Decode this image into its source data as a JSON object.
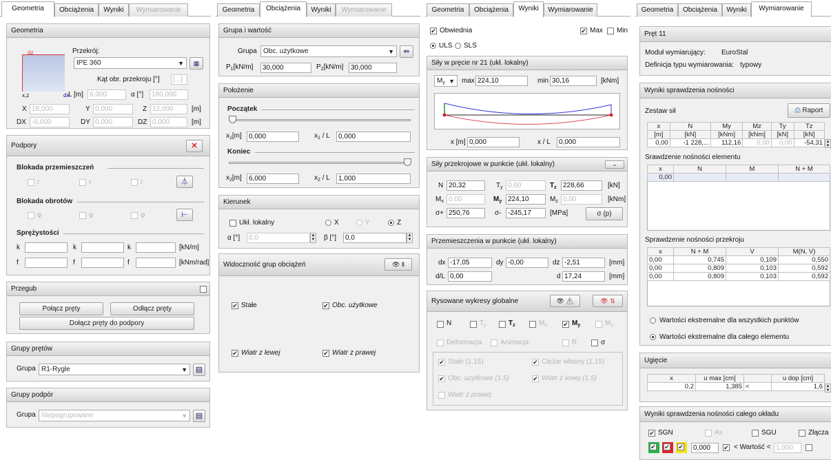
{
  "tabs": {
    "geometria": "Geometria",
    "obciazenia": "Obciążenia",
    "wyniki": "Wyniki",
    "wymiarowanie": "Wymiarowanie"
  },
  "p1": {
    "geom_title": "Geometria",
    "przekroj_label": "Przekrój:",
    "przekroj_value": "IPE 360",
    "kat_label": "Kąt obr. przekroju [°]",
    "kat_value": "[...]",
    "dz": "dz",
    "xz": "x,z",
    "dx": "dx",
    "L_label": "L [m]",
    "L_value": "6,000",
    "alfa_label": "α [°]",
    "alfa_value": "180,000",
    "X_label": "X",
    "X_value": "18,000",
    "Y_label": "Y",
    "Y_value": "0,000",
    "Z_label": "Z",
    "Z_value": "12,000",
    "unit_m": "[m]",
    "DX_label": "DX",
    "DX_value": "-6,000",
    "DY_label": "DY",
    "DY_value": "0,000",
    "DZ_label": "DZ",
    "DZ_value": "0,000",
    "podpory_title": "Podpory",
    "blokada_przem": "Blokada przemieszczeń",
    "blokada_obr": "Blokada obrotów",
    "sprezystosci": "Sprężystości",
    "ux": "r",
    "uy": "r",
    "uz": "r",
    "phix": "φ",
    "phiy": "φ",
    "phiz": "φ",
    "kx": "k",
    "ky": "k",
    "kz": "k",
    "fx": "f",
    "fy": "f",
    "fz": "f",
    "unit_kn_m": "[kN/m]",
    "unit_knm_rad": "[kNm/rad]",
    "przegub_title": "Przegub",
    "polacz": "Połącz pręty",
    "odlacz": "Odłącz pręty",
    "dolacz": "Dołącz pręty do podpory",
    "grupy_pretow": "Grupy prętów",
    "grupa_label": "Grupa",
    "grupa_value": "R1-Rygle",
    "grupy_podpor": "Grupy podpór",
    "grupa2_value": "Niepogrupowane"
  },
  "p2": {
    "grupa_title": "Grupa i wartość",
    "grupa_label": "Grupa",
    "grupa_value": "Obc. użytkowe",
    "P1_label": "P",
    "P1_unit": "[kN/m]",
    "P1_value": "30,000",
    "P2_label": "P",
    "P2_unit": "[kN/m]",
    "P2_value": "30,000",
    "polozenie_title": "Położenie",
    "poczatek": "Początek",
    "koniec": "Koniec",
    "x1_label": "x",
    "x1_unit": "[m]",
    "x1_value": "0,000",
    "x1L_label": "x",
    "x1L_unit": "/ L",
    "x1L_value": "0,000",
    "x2_label": "x",
    "x2_unit": "[m]",
    "x2_value": "6,000",
    "x2L_label": "x",
    "x2L_unit": "/ L",
    "x2L_value": "1,000",
    "kierunek_title": "Kierunek",
    "ukl_lokalny": "Ukł. lokalny",
    "rX": "X",
    "rY": "Y",
    "rZ": "Z",
    "alfa_label": "α [°]",
    "alfa_value": "0,0",
    "beta_label": "β [°]",
    "beta_value": "0,0",
    "widocznosc_title": "Widoczność grup obciążeń",
    "stale": "Stałe",
    "obc_uzytkowe": "Obc. użytkowe",
    "wiatr_lewej": "Wiatr z lewej",
    "wiatr_prawej": "Wiatr z prawej"
  },
  "p3": {
    "obwiednia": "Obwiednia",
    "max": "Max",
    "min": "Min",
    "uls": "ULS",
    "sls": "SLS",
    "sily_title": "Siły w pręcie nr 21 (ukł. lokalny)",
    "my_sel": "M",
    "max_label": "max",
    "max_value": "224,10",
    "min_label": "min",
    "min_value": "30,16",
    "unit_knm": "[kNm]",
    "x_label": "x [m]",
    "x_value": "0,000",
    "xL_label": "x / L",
    "xL_value": "0,000",
    "przek_title": "Siły przekrojowe w punkcie (ukł. lokalny)",
    "N_label": "N",
    "N_value": "20,32",
    "Ty_label": "T",
    "Ty_value": "0,00",
    "Tz_label": "T",
    "Tz_value": "228,66",
    "unit_kn": "[kN]",
    "Mx_label": "M",
    "Mx_value": "0,00",
    "My_label": "M",
    "My_value": "224,10",
    "Mz_label": "M",
    "Mz_value": "0,00",
    "sp_label": "σ+",
    "sp_value": "250,76",
    "sm_label": "σ-",
    "sm_value": "-245,17",
    "unit_mpa": "[MPa]",
    "sigma_btn": "σ (p)",
    "przem_title": "Przemieszczenia w punkcie (ukł. lokalny)",
    "dx_label": "dx",
    "dx_value": "-17,05",
    "dy_label": "dy",
    "dy_value": "-0,00",
    "dz_label": "dz",
    "dz_value": "-2,51",
    "unit_mm": "[mm]",
    "dL_label": "d/L",
    "dL_value": "0,00",
    "d_label": "d",
    "d_value": "17,24",
    "rys_title": "Rysowane wykresy globalne",
    "cN": "N",
    "cTy": "T",
    "cTz": "T",
    "cMx": "M",
    "cMy": "M",
    "cMz": "M",
    "deformacja": "Deformacja",
    "animacja": "Animacja",
    "cR": "R",
    "csigma": "σ",
    "l_stale": "Stałe (1.15)",
    "l_ciezar": "Ciężar własny (1.15)",
    "l_obc": "Obc. użytkowe (1.5)",
    "l_wiatr_l": "Wiatr z lewej (1.5)",
    "l_wiatr_p": "Wiatr z prawej"
  },
  "p4": {
    "pret_title": "Pręt 11",
    "modul_label": "Moduł wymiarujący:",
    "modul_value": "EuroStal",
    "def_label": "Definicja typu wymiarowania:",
    "def_value": "typowy",
    "wyniki_title": "Wyniki sprawdzenia nośności",
    "zestaw": "Zestaw sił",
    "raport": "Raport",
    "t1": {
      "head1": [
        "x",
        "N",
        "My",
        "Mz",
        "Ty",
        "Tz"
      ],
      "head2": [
        "[m]",
        "[kN]",
        "[kNm]",
        "[kNm]",
        "[kN]",
        "[kN]"
      ],
      "row": [
        "0,00",
        "-1 228,...",
        "112,16",
        "0,00",
        "0,00",
        "-54,31"
      ]
    },
    "srawdzenie_el": "Srawdzenie nośności elementu",
    "t2": {
      "head": [
        "x",
        "N",
        "M",
        "N + M"
      ],
      "row": [
        "0,00",
        "",
        "",
        ""
      ]
    },
    "sprawdzenie_prz": "Sprawdzenie nośności przekroju",
    "t3": {
      "head": [
        "x",
        "N + M",
        "V",
        "M(N, V)"
      ],
      "rows": [
        [
          "0,00",
          "0,745",
          "0,109",
          "0,550"
        ],
        [
          "0,00",
          "0,809",
          "0,103",
          "0,592"
        ],
        [
          "0,00",
          "0,809",
          "0,103",
          "0,592"
        ]
      ]
    },
    "radio1": "Wartości ekstremalne dla wszystkich punktów",
    "radio2": "Wartości ekstremalne dla całego elementu",
    "ugiecie_title": "Ugięcie",
    "t4": {
      "head": [
        "x",
        "u max [cm]",
        "",
        "u dop [cm]"
      ],
      "row": [
        "0,2",
        "1,385",
        "<",
        "1,6"
      ]
    },
    "caly_title": "Wyniki sprawdzenia nośności całego układu",
    "sgn": "SGN",
    "as": "As",
    "sgu": "SGU",
    "zlacza": "Złącza",
    "val1": "0,000",
    "wartosc": "< Wartość <",
    "val2": "1,000"
  },
  "colors": {
    "green": "#27b24a",
    "red": "#e0262b",
    "yellow": "#f1e21b"
  }
}
